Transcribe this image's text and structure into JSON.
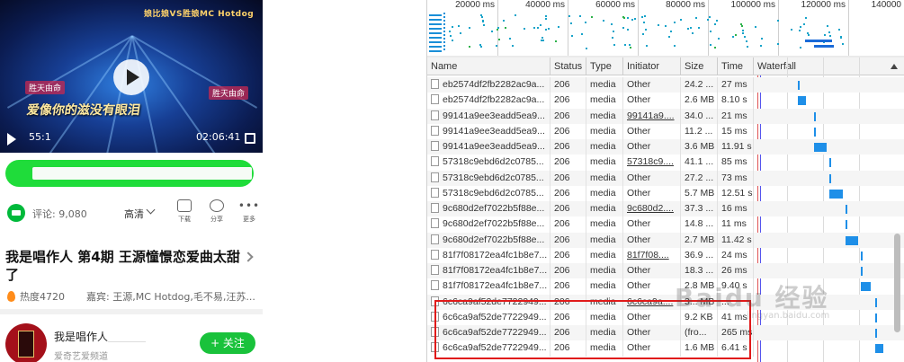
{
  "mobile": {
    "video": {
      "banner": "娘比娘VS胜娘MC Hotdog",
      "caption": "爱像你的滋没有眼泪",
      "badge_left": "胜天由命",
      "badge_right": "胜天由命",
      "current_time": "55:1",
      "total_time": "02:06:41"
    },
    "comment_count": "评论: 9,080",
    "quality": "高清",
    "actions": {
      "download": "下载",
      "share": "分享",
      "more": "更多"
    },
    "title": "我是唱作人 第4期 王源憧憬恋爱曲太甜了",
    "heat": "热度4720",
    "guests": "嘉宾: 王源,MC Hotdog,毛不易,汪苏...",
    "channel": {
      "name": "我是唱作人",
      "subtitle": "爱奇艺爱频道",
      "follow": "+ 关注"
    }
  },
  "devtools": {
    "overview_ticks": [
      "20000 ms",
      "40000 ms",
      "60000 ms",
      "80000 ms",
      "100000 ms",
      "120000 ms",
      "140000"
    ],
    "columns": [
      "Name",
      "Status",
      "Type",
      "Initiator",
      "Size",
      "Time",
      "Waterfall"
    ],
    "rows": [
      {
        "name": "eb2574df2fb2282ac9a...",
        "status": "206",
        "type": "media",
        "initiator": "Other",
        "link": false,
        "size": "24.2 ...",
        "time": "27 ms",
        "wf_start": 0.29,
        "wf_width": 0.01
      },
      {
        "name": "eb2574df2fb2282ac9a...",
        "status": "206",
        "type": "media",
        "initiator": "Other",
        "link": false,
        "size": "2.6 MB",
        "time": "8.10 s",
        "wf_start": 0.29,
        "wf_width": 0.07
      },
      {
        "name": "99141a9ee3eadd5ea9...",
        "status": "206",
        "type": "media",
        "initiator": "99141a9....",
        "link": true,
        "size": "34.0 ...",
        "time": "21 ms",
        "wf_start": 0.42,
        "wf_width": 0.01
      },
      {
        "name": "99141a9ee3eadd5ea9...",
        "status": "206",
        "type": "media",
        "initiator": "Other",
        "link": false,
        "size": "11.2 ...",
        "time": "15 ms",
        "wf_start": 0.42,
        "wf_width": 0.01
      },
      {
        "name": "99141a9ee3eadd5ea9...",
        "status": "206",
        "type": "media",
        "initiator": "Other",
        "link": false,
        "size": "3.6 MB",
        "time": "11.91 s",
        "wf_start": 0.42,
        "wf_width": 0.1
      },
      {
        "name": "57318c9ebd6d2c0785...",
        "status": "206",
        "type": "media",
        "initiator": "57318c9....",
        "link": true,
        "size": "41.1 ...",
        "time": "85 ms",
        "wf_start": 0.54,
        "wf_width": 0.01
      },
      {
        "name": "57318c9ebd6d2c0785...",
        "status": "206",
        "type": "media",
        "initiator": "Other",
        "link": false,
        "size": "27.2 ...",
        "time": "73 ms",
        "wf_start": 0.54,
        "wf_width": 0.01
      },
      {
        "name": "57318c9ebd6d2c0785...",
        "status": "206",
        "type": "media",
        "initiator": "Other",
        "link": false,
        "size": "5.7 MB",
        "time": "12.51 s",
        "wf_start": 0.54,
        "wf_width": 0.11
      },
      {
        "name": "9c680d2ef7022b5f88e...",
        "status": "206",
        "type": "media",
        "initiator": "9c680d2....",
        "link": true,
        "size": "37.3 ...",
        "time": "16 ms",
        "wf_start": 0.67,
        "wf_width": 0.01
      },
      {
        "name": "9c680d2ef7022b5f88e...",
        "status": "206",
        "type": "media",
        "initiator": "Other",
        "link": false,
        "size": "14.8 ...",
        "time": "11 ms",
        "wf_start": 0.67,
        "wf_width": 0.01
      },
      {
        "name": "9c680d2ef7022b5f88e...",
        "status": "206",
        "type": "media",
        "initiator": "Other",
        "link": false,
        "size": "2.7 MB",
        "time": "11.42 s",
        "wf_start": 0.67,
        "wf_width": 0.1
      },
      {
        "name": "81f7f08172ea4fc1b8e7...",
        "status": "206",
        "type": "media",
        "initiator": "81f7f08....",
        "link": true,
        "size": "36.9 ...",
        "time": "24 ms",
        "wf_start": 0.79,
        "wf_width": 0.01
      },
      {
        "name": "81f7f08172ea4fc1b8e7...",
        "status": "206",
        "type": "media",
        "initiator": "Other",
        "link": false,
        "size": "18.3 ...",
        "time": "26 ms",
        "wf_start": 0.79,
        "wf_width": 0.01
      },
      {
        "name": "81f7f08172ea4fc1b8e7...",
        "status": "206",
        "type": "media",
        "initiator": "Other",
        "link": false,
        "size": "2.8 MB",
        "time": "9.40 s",
        "wf_start": 0.79,
        "wf_width": 0.08
      },
      {
        "name": "6c6ca9af52de7722949...",
        "status": "206",
        "type": "media",
        "initiator": "6c6ca9a....",
        "link": true,
        "size": "3... MB",
        "time": "...",
        "wf_start": 0.91,
        "wf_width": 0.01
      },
      {
        "name": "6c6ca9af52de7722949...",
        "status": "206",
        "type": "media",
        "initiator": "Other",
        "link": false,
        "size": "9.2 KB",
        "time": "41 ms",
        "wf_start": 0.91,
        "wf_width": 0.01
      },
      {
        "name": "6c6ca9af52de7722949...",
        "status": "206",
        "type": "media",
        "initiator": "Other",
        "link": false,
        "size": "(fro...",
        "time": "265 ms",
        "wf_start": 0.91,
        "wf_width": 0.01
      },
      {
        "name": "6c6ca9af52de7722949...",
        "status": "206",
        "type": "media",
        "initiator": "Other",
        "link": false,
        "size": "1.6 MB",
        "time": "6.41 s",
        "wf_start": 0.91,
        "wf_width": 0.06
      }
    ]
  },
  "watermark": {
    "text": "Baidu 经验",
    "sub": "jingyan.baidu.com"
  },
  "colors": {
    "accent_green": "#1fdc3a",
    "bar_blue": "#1e8fe8",
    "highlight_red": "#e01a1a"
  }
}
